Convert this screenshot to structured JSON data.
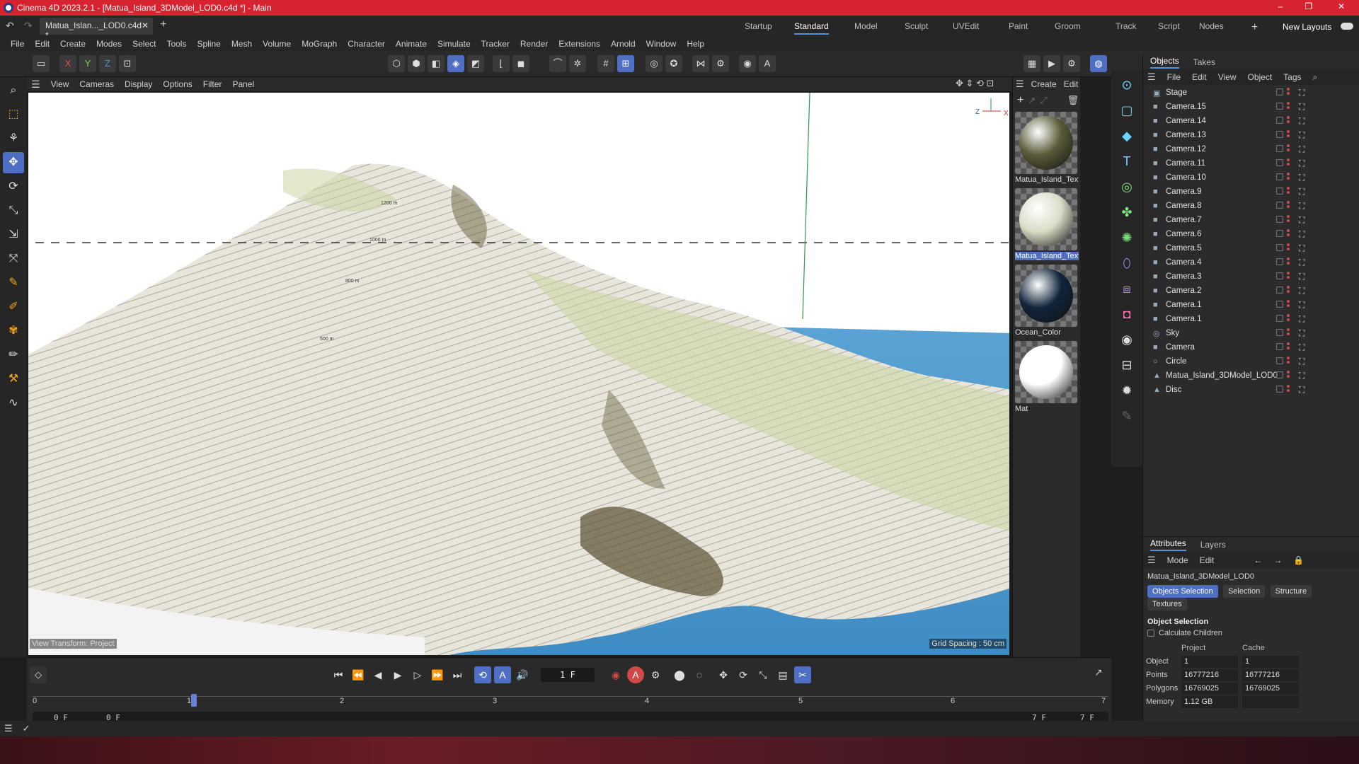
{
  "window": {
    "title": "Cinema 4D 2023.2.1 - [Matua_Island_3DModel_LOD0.c4d *] - Main",
    "controls": [
      "–",
      "❐",
      "✕"
    ]
  },
  "tabs": {
    "doc_tab": "Matua_Islan..._LOD0.c4d *",
    "new_tab": "+",
    "layouts": [
      "Startup",
      "Standard",
      "Model",
      "Sculpt",
      "UVEdit",
      "Paint",
      "Groom",
      "Track",
      "Script",
      "Nodes"
    ],
    "active_layout": "Standard",
    "new_layouts": "New Layouts"
  },
  "menu": [
    "File",
    "Edit",
    "Create",
    "Modes",
    "Select",
    "Tools",
    "Spline",
    "Mesh",
    "Volume",
    "MoGraph",
    "Character",
    "Animate",
    "Simulate",
    "Tracker",
    "Render",
    "Extensions",
    "Arnold",
    "Window",
    "Help"
  ],
  "toolbar": {
    "axes": [
      "X",
      "Y",
      "Z"
    ]
  },
  "viewport": {
    "menu": [
      "View",
      "Cameras",
      "Display",
      "Options",
      "Filter",
      "Panel"
    ],
    "view_transform": "View Transform: Project",
    "grid_spacing": "Grid Spacing : 50 cm",
    "contour_labels": [
      "1200 m",
      "1000 m",
      "800 m",
      "500 m"
    ],
    "axis_labels": {
      "z": "Z",
      "x": "X"
    }
  },
  "materials": {
    "menu": [
      "Create",
      "Edit"
    ],
    "items": [
      {
        "name": "Matua_Island_Text",
        "selected": false,
        "color": "#5a5a3a"
      },
      {
        "name": "Matua_Island_Text",
        "selected": true,
        "color": "#dcdcc8"
      },
      {
        "name": "Ocean_Color",
        "selected": false,
        "color": "#10243a"
      },
      {
        "name": "Mat",
        "selected": false,
        "color": "#ffffff"
      }
    ]
  },
  "objects": {
    "tabs": [
      "Objects",
      "Takes"
    ],
    "menu": [
      "File",
      "Edit",
      "View",
      "Object",
      "Tags"
    ],
    "rows": [
      {
        "name": "Stage",
        "icon": "▣"
      },
      {
        "name": "Camera.15",
        "icon": "■"
      },
      {
        "name": "Camera.14",
        "icon": "■"
      },
      {
        "name": "Camera.13",
        "icon": "■"
      },
      {
        "name": "Camera.12",
        "icon": "■"
      },
      {
        "name": "Camera.11",
        "icon": "■"
      },
      {
        "name": "Camera.10",
        "icon": "■"
      },
      {
        "name": "Camera.9",
        "icon": "■"
      },
      {
        "name": "Camera.8",
        "icon": "■"
      },
      {
        "name": "Camera.7",
        "icon": "■"
      },
      {
        "name": "Camera.6",
        "icon": "■"
      },
      {
        "name": "Camera.5",
        "icon": "■"
      },
      {
        "name": "Camera.4",
        "icon": "■"
      },
      {
        "name": "Camera.3",
        "icon": "■"
      },
      {
        "name": "Camera.2",
        "icon": "■"
      },
      {
        "name": "Camera.1",
        "icon": "■"
      },
      {
        "name": "Camera.1",
        "icon": "■"
      },
      {
        "name": "Sky",
        "icon": "◎"
      },
      {
        "name": "Camera",
        "icon": "■"
      },
      {
        "name": "Circle",
        "icon": "○"
      },
      {
        "name": "Matua_Island_3DModel_LOD0",
        "icon": "▲"
      },
      {
        "name": "Disc",
        "icon": "▲"
      }
    ]
  },
  "attributes": {
    "tabs": [
      "Attributes",
      "Layers"
    ],
    "menu": [
      "Mode",
      "Edit"
    ],
    "object_name": "Matua_Island_3DModel_LOD0",
    "buttons": [
      "Objects Selection",
      "Selection",
      "Structure",
      "Textures"
    ],
    "section": "Object Selection",
    "calc_children": "Calculate Children",
    "col_project": "Project",
    "col_cache": "Cache",
    "rows": [
      {
        "label": "Object",
        "project": "1",
        "cache": "1"
      },
      {
        "label": "Points",
        "project": "16777216",
        "cache": "16777216"
      },
      {
        "label": "Polygons",
        "project": "16769025",
        "cache": "16769025"
      },
      {
        "label": "Memory",
        "project": "1.12 GB",
        "cache": ""
      }
    ]
  },
  "timeline": {
    "current_frame": "1 F",
    "ruler": [
      "0",
      "1",
      "2",
      "3",
      "4",
      "5",
      "6",
      "7"
    ],
    "start": "0 F",
    "start2": "0 F",
    "end": "7 F",
    "end2": "7 F"
  }
}
